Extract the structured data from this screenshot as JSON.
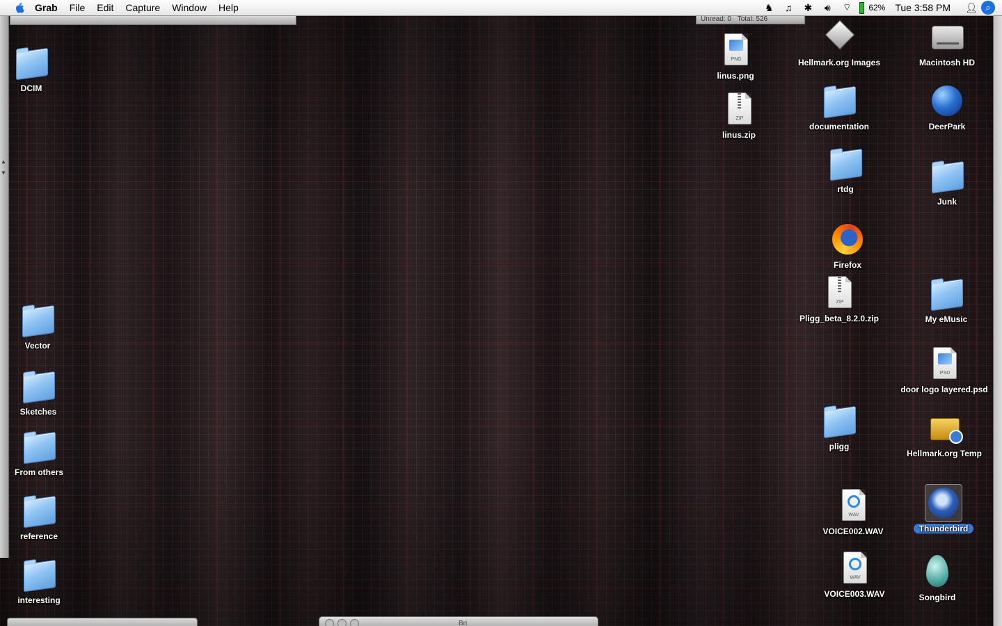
{
  "menubar": {
    "app": "Grab",
    "menus": [
      "File",
      "Edit",
      "Capture",
      "Window",
      "Help"
    ],
    "battery": "62%",
    "clock": "Tue 3:58 PM"
  },
  "mail_window": {
    "unread": "Unread: 0",
    "total": "Total: 526"
  },
  "bottom_window": {
    "title": "Bri"
  },
  "desktop": {
    "left_icons": [
      {
        "label": "DCIM",
        "type": "folder"
      },
      {
        "label": "Vector",
        "type": "folder"
      },
      {
        "label": "Sketches",
        "type": "folder"
      },
      {
        "label": "From others",
        "type": "folder"
      },
      {
        "label": "reference",
        "type": "folder"
      },
      {
        "label": "interesting",
        "type": "folder"
      }
    ],
    "right_icons": [
      {
        "label": "linus.png",
        "type": "png"
      },
      {
        "label": "linus.zip",
        "type": "zip"
      },
      {
        "label": "Hellmark.org Images",
        "type": "server"
      },
      {
        "label": "documentation",
        "type": "folder"
      },
      {
        "label": "rtdg",
        "type": "folder"
      },
      {
        "label": "Firefox",
        "type": "firefox"
      },
      {
        "label": "Pligg_beta_8.2.0.zip",
        "type": "zip"
      },
      {
        "label": "pligg",
        "type": "folder"
      },
      {
        "label": "VOICE002.WAV",
        "type": "wav"
      },
      {
        "label": "VOICE003.WAV",
        "type": "wav"
      },
      {
        "label": "Macintosh HD",
        "type": "disk"
      },
      {
        "label": "DeerPark",
        "type": "globe"
      },
      {
        "label": "Junk",
        "type": "folder"
      },
      {
        "label": "My eMusic",
        "type": "folder"
      },
      {
        "label": "door logo layered.psd",
        "type": "psd"
      },
      {
        "label": "Hellmark.org Temp",
        "type": "toolbox"
      },
      {
        "label": "Thunderbird",
        "type": "thunderbird",
        "selected": true
      },
      {
        "label": "Songbird",
        "type": "songbird"
      }
    ]
  },
  "colors": {
    "selection": "#3875d7",
    "battery": "#2bb52b",
    "spotlight": "#1d6fdb"
  }
}
